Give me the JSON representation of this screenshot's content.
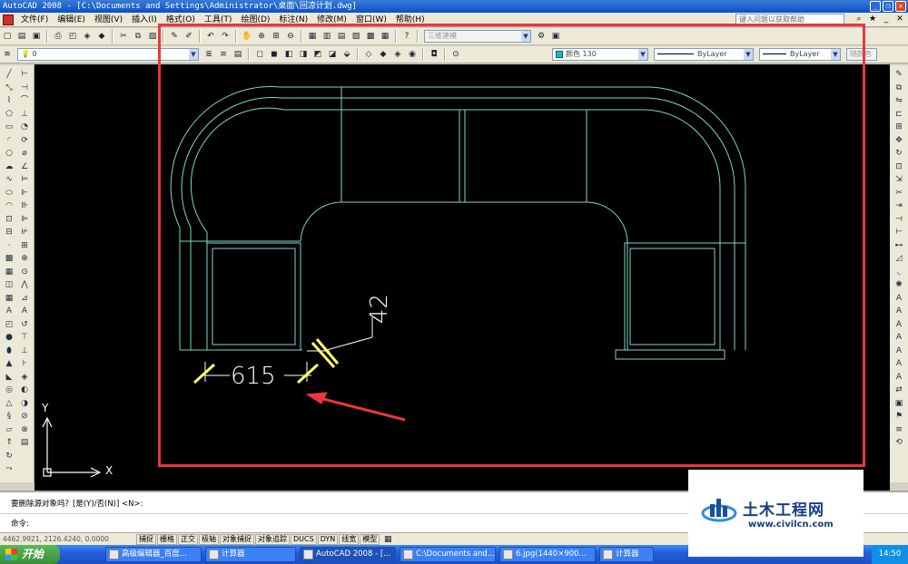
{
  "window": {
    "title": "AutoCAD 2008 - [C:\\Documents and Settings\\Administrator\\桌面\\回凉计划.dwg]"
  },
  "menu": {
    "items": [
      "文件(F)",
      "编辑(E)",
      "视图(V)",
      "插入(I)",
      "格式(O)",
      "工具(T)",
      "绘图(D)",
      "标注(N)",
      "修改(M)",
      "窗口(W)",
      "帮助(H)"
    ],
    "help_placeholder": "键入问题以获取帮助"
  },
  "toolbar": {
    "workspace_combo": "三维建模",
    "layer_combo": "0",
    "color_combo": "颜色 130",
    "linetype_combo": "ByLayer",
    "lineweight_combo": "ByLayer",
    "plotstyle_combo": "随颜色"
  },
  "drawing": {
    "dimension_horizontal": "615",
    "dimension_vertical": "42",
    "ucs_x": "X",
    "ucs_y": "Y",
    "line_color": "#7ad7c8",
    "dim_color": "#ffffff",
    "tick_color": "#ffff66",
    "highlight_color": "#e8383d",
    "arrow_color": "#e8383d"
  },
  "command": {
    "prompt_history": "要删除源对象吗？[是(Y)/否(N)] <N>:",
    "current_prompt": "命令:"
  },
  "status": {
    "coordinates": "4462.9921, 2126.4240, 0.0000",
    "toggles": [
      "捕捉",
      "栅格",
      "正交",
      "极轴",
      "对象捕捉",
      "对象追踪",
      "DUCS",
      "DYN",
      "线宽",
      "模型"
    ]
  },
  "taskbar": {
    "start_label": "开始",
    "tasks": [
      "高级编辑器_百度...",
      "计算器",
      "AutoCAD 2008 - [...",
      "C:\\Documents and...",
      "6.jpg(1440×900...",
      "计算器"
    ],
    "clock": "14:50"
  },
  "watermark": {
    "title": "土木工程网",
    "url": "www.civilcn.com"
  }
}
